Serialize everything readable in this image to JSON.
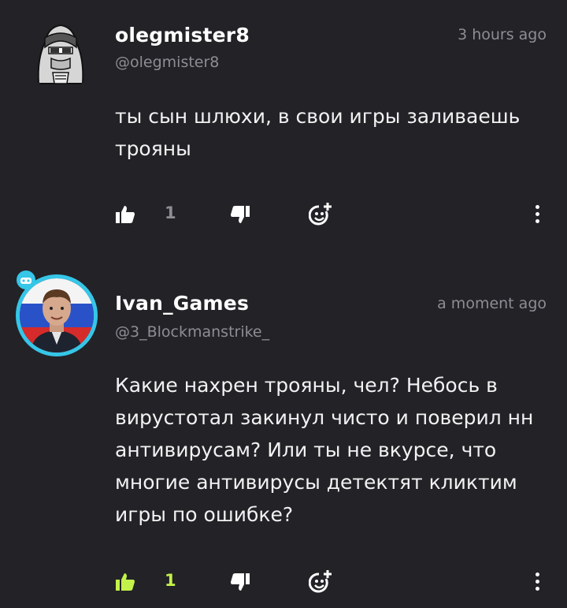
{
  "comments": [
    {
      "username": "olegmister8",
      "handle": "@olegmister8",
      "time": "3 hours ago",
      "text": "ты сын шлюхи, в свои игры заливаешь трояны",
      "likes": "1",
      "liked": false
    },
    {
      "username": "Ivan_Games",
      "handle": "@3_Blockmanstrike_",
      "time": "a moment ago",
      "text": "Какие нахрен трояны, чел? Небось в вирустотал закинул чисто и поверил нн антивирусам? Или ты не вкурсе, что многие антивирусы детектят кликтим игры по ошибке?",
      "likes": "1",
      "liked": true
    }
  ],
  "colors": {
    "background": "#232227",
    "muted": "#8e8d93",
    "accent": "#c3f24a",
    "ring": "#35c6e8"
  },
  "icons": {
    "like": "thumbs-up-icon",
    "dislike": "thumbs-down-icon",
    "react": "add-emoji-icon",
    "more": "more-vertical-icon"
  }
}
